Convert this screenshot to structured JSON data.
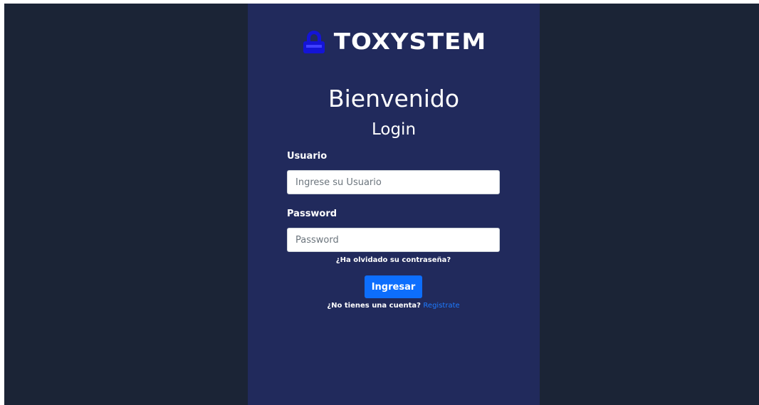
{
  "brand": {
    "name": "TOXYSTEM",
    "icon": "lock-icon"
  },
  "header": {
    "title": "Bienvenido",
    "subtitle": "Login"
  },
  "form": {
    "username": {
      "label": "Usuario",
      "placeholder": "Ingrese su Usuario",
      "value": ""
    },
    "password": {
      "label": "Password",
      "placeholder": "Password",
      "value": ""
    },
    "forgot_link": "¿Ha olvidado su contraseña?",
    "submit_label": "Ingresar",
    "register_prompt": "¿No tienes una cuenta?",
    "register_link": "Registrate"
  },
  "colors": {
    "background": "#1b2436",
    "panel": "#212a5c",
    "accent": "#0d6efd",
    "logo_icon": "#1414d6"
  }
}
